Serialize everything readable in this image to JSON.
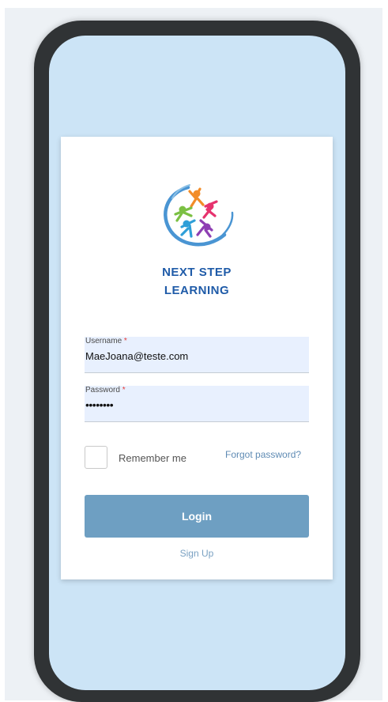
{
  "brand": {
    "logo_icon": "next-step-learning-logo-icon",
    "name_line1": "NEXT STEP",
    "name_line2": "LEARNING"
  },
  "form": {
    "username": {
      "label": "Username",
      "required_mark": "*",
      "value": "MaeJoana@teste.com"
    },
    "password": {
      "label": "Password",
      "required_mark": "*",
      "value": "12345678"
    },
    "remember_label": "Remember me",
    "remember_checked": false,
    "forgot_label": "Forgot password?",
    "login_label": "Login",
    "signup_label": "Sign Up"
  },
  "colors": {
    "screen_background": "#cce4f6",
    "brand_text": "#1f5ba8",
    "login_button": "#6e9fc2",
    "link": "#5f8bb4",
    "input_background": "#e8f0fe"
  }
}
